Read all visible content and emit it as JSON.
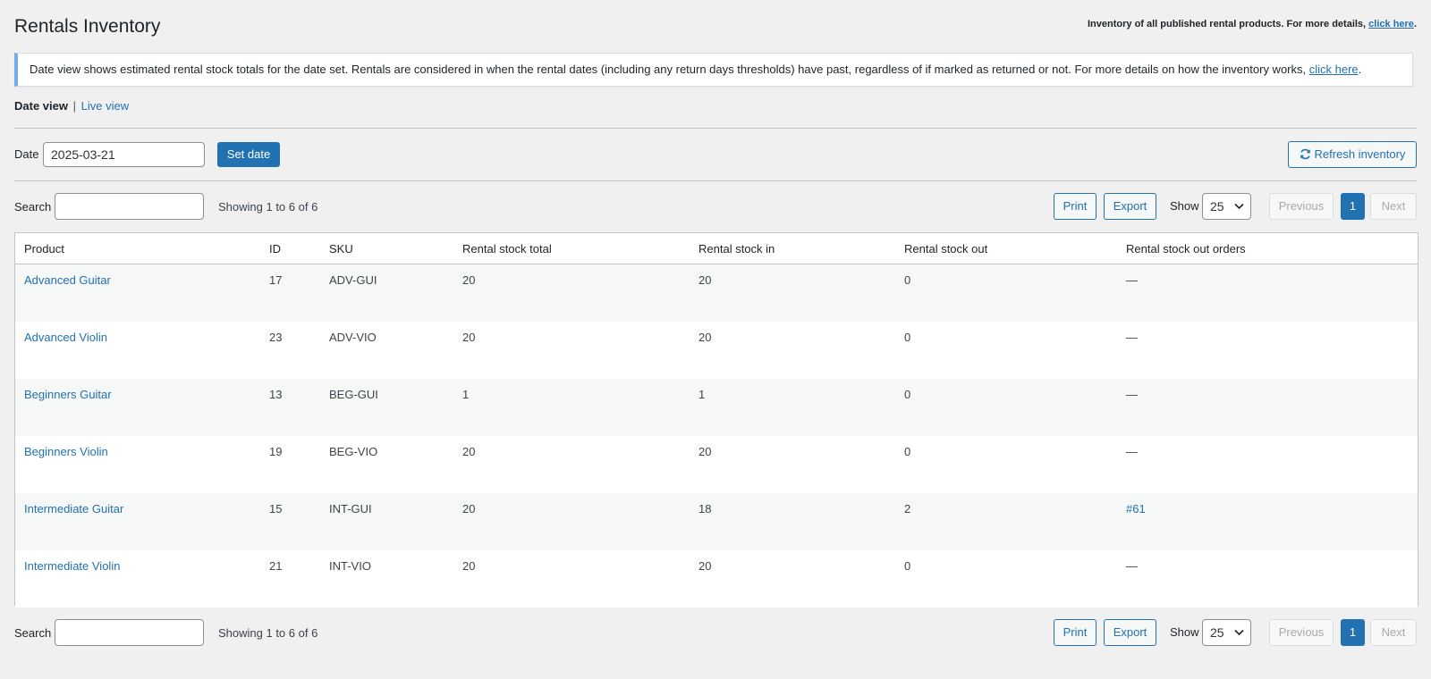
{
  "header": {
    "title": "Rentals Inventory",
    "note_text": "Inventory of all published rental products. For more details, ",
    "note_link": "click here",
    "note_end": "."
  },
  "notice": {
    "text": "Date view shows estimated rental stock totals for the date set. Rentals are considered in when the rental dates (including any return days thresholds) have past, regardless of if marked as returned or not. For more details on how the inventory works, ",
    "link": "click here",
    "end": "."
  },
  "views": {
    "current": "Date view",
    "separator": "|",
    "other": "Live view"
  },
  "date_form": {
    "label": "Date",
    "value": "2025-03-21",
    "set_button": "Set date"
  },
  "refresh_button": "Refresh inventory",
  "controls": {
    "search_label": "Search",
    "showing": "Showing 1 to 6 of 6",
    "print": "Print",
    "export": "Export",
    "show_label": "Show",
    "show_value": "25",
    "previous": "Previous",
    "page": "1",
    "next": "Next"
  },
  "table": {
    "headers": [
      "Product",
      "ID",
      "SKU",
      "Rental stock total",
      "Rental stock in",
      "Rental stock out",
      "Rental stock out orders"
    ],
    "rows": [
      {
        "product": "Advanced Guitar",
        "id": "17",
        "sku": "ADV-GUI",
        "total": "20",
        "in": "20",
        "out": "0",
        "orders": "—"
      },
      {
        "product": "Advanced Violin",
        "id": "23",
        "sku": "ADV-VIO",
        "total": "20",
        "in": "20",
        "out": "0",
        "orders": "—"
      },
      {
        "product": "Beginners Guitar",
        "id": "13",
        "sku": "BEG-GUI",
        "total": "1",
        "in": "1",
        "out": "0",
        "orders": "—"
      },
      {
        "product": "Beginners Violin",
        "id": "19",
        "sku": "BEG-VIO",
        "total": "20",
        "in": "20",
        "out": "0",
        "orders": "—"
      },
      {
        "product": "Intermediate Guitar",
        "id": "15",
        "sku": "INT-GUI",
        "total": "20",
        "in": "18",
        "out": "2",
        "orders": "#61"
      },
      {
        "product": "Intermediate Violin",
        "id": "21",
        "sku": "INT-VIO",
        "total": "20",
        "in": "20",
        "out": "0",
        "orders": "—"
      }
    ]
  },
  "icons": {
    "refresh": "refresh-icon",
    "select": "chevron-down-icon"
  },
  "colors": {
    "accent": "#2271b1",
    "notice_border": "#72aee6",
    "background": "#f0f0f1"
  }
}
